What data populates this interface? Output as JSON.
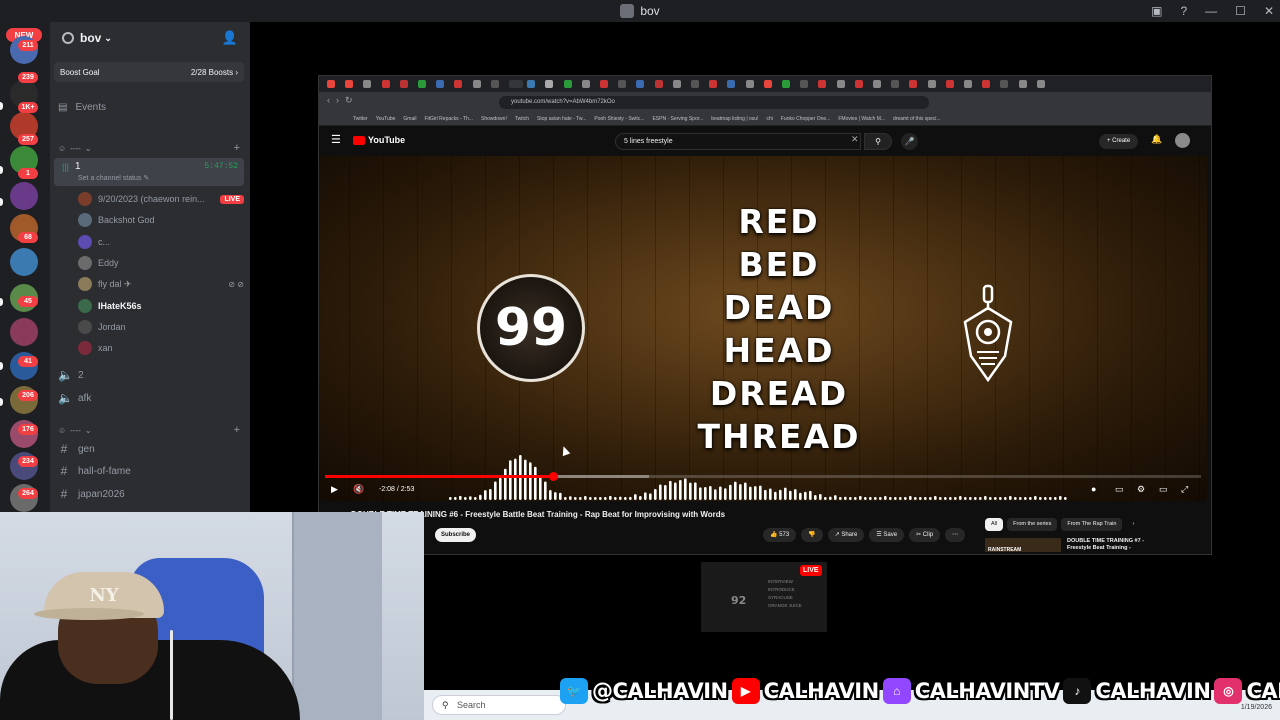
{
  "window": {
    "title": "bov"
  },
  "rail": {
    "new_label": "NEW",
    "badges": [
      "211",
      "239",
      "1K+",
      "257",
      "1",
      "68",
      "45",
      "41",
      "206",
      "176",
      "234",
      "264"
    ]
  },
  "server": {
    "name": "bov",
    "boost_label": "Boost Goal",
    "boost_count": "2/28 Boosts",
    "events_label": "Events",
    "category1": "----",
    "category2": "----"
  },
  "voice_channel": {
    "name": "1",
    "status": "Set a channel status",
    "timer": "5:47:52",
    "members": [
      {
        "name": "9/20/2023 (chaewon rein...",
        "live": "LIVE",
        "color": "#7a3d2a"
      },
      {
        "name": "Backshot God",
        "color": "#5a6a7a"
      },
      {
        "name": "c...",
        "color": "#5c4bb0"
      },
      {
        "name": "Eddy",
        "color": "#6b6b6b"
      },
      {
        "name": "fly dal ✈",
        "color": "#8a7a5a"
      },
      {
        "name": "IHateK56s",
        "color": "#3a6a4a",
        "bold": true
      },
      {
        "name": "Jordan",
        "color": "#4a4a4a"
      },
      {
        "name": "xan",
        "color": "#7a2a3a"
      }
    ]
  },
  "channels": {
    "voice": [
      "2",
      "afk"
    ],
    "text": [
      "gen",
      "hall-of-fame",
      "japan2026"
    ]
  },
  "browser": {
    "url": "youtube.com/watch?v=AbW4bm72kOo",
    "bookmarks": [
      "Twitter",
      "YouTube",
      "Gmail",
      "FitGirl Repacks - Th...",
      "Showdown!",
      "Twitch",
      "Stop asian hate - Tw...",
      "Pooh Shiesty - Switc...",
      "ESPN - Serving Spor...",
      "beatmap listing | osu!",
      "chi",
      "Funko Chopper One...",
      "FMovies | Watch M...",
      "dreamt of this speci..."
    ]
  },
  "youtube": {
    "logo": "YouTube",
    "search_query": "5 lines freestyle",
    "create_label": "Create",
    "counter": "99",
    "words": [
      "RED",
      "BED",
      "DEAD",
      "HEAD",
      "DREAD",
      "THREAD"
    ],
    "time": "-2:08 / 2:53",
    "progress_played": 0.26,
    "progress_buffered": 0.37,
    "video_title": "DOUBLE TIME TRAINING #6 - Freestyle Battle Beat Training - Rap Beat for Improvising with Words",
    "subscribe": "Subscribe",
    "likes": "573",
    "share": "Share",
    "save": "Save",
    "clip": "Clip",
    "chips": [
      "All",
      "From the series",
      "From The Rap Train"
    ],
    "next_title": "DOUBLE TIME TRAINING #7 - Freestyle Beat Training -",
    "next_thumb_text": "RAINSTREAM"
  },
  "stream_thumb": {
    "live": "LIVE",
    "number": "92",
    "words": [
      "INTERVIEW",
      "INTRODUCE",
      "SYRACUSE",
      "ORANGE JUICE"
    ]
  },
  "taskbar": {
    "search_placeholder": "Search",
    "date": "1/19/2026"
  },
  "socials": {
    "items": [
      {
        "icon": "twitter",
        "text": "@CALHAVIN",
        "color": "#1da1f2"
      },
      {
        "icon": "youtube",
        "text": "CALHAVIN",
        "color": "#ff0000"
      },
      {
        "icon": "twitch",
        "text": "CALHAVINTV",
        "color": "#9146ff"
      },
      {
        "icon": "tiktok",
        "text": "CALHAVIN",
        "color": "#111111"
      },
      {
        "icon": "instagram",
        "text": "CAL.HAVIN",
        "color": "#e1306c"
      }
    ]
  },
  "colors": {
    "discord_bg": "#2b2d31",
    "rail_bg": "#1e1f22",
    "accent_red": "#f23f43",
    "voice_green": "#23a559",
    "yt_red": "#ff0000"
  }
}
